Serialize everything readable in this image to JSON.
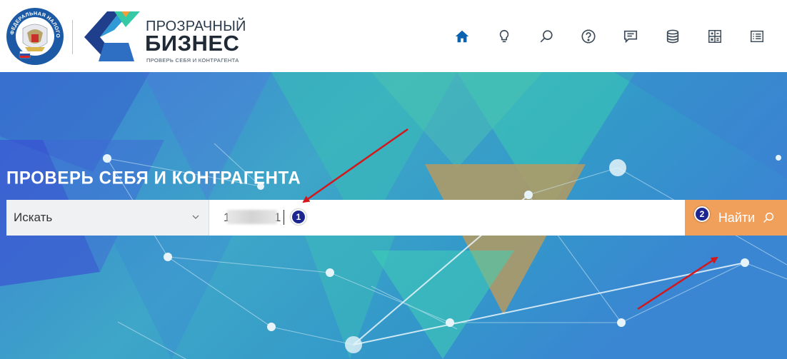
{
  "header": {
    "brand_line1": "ПРОЗРАЧНЫЙ",
    "brand_line2": "БИЗНЕС",
    "brand_tagline": "ПРОВЕРЬ СЕБЯ И КОНТРАГЕНТА",
    "emblem_text": "ФЕДЕРАЛЬНАЯ НАЛОГОВАЯ СЛУЖБА",
    "nav_icons": [
      "home-icon",
      "lightbulb-icon",
      "search-icon",
      "help-icon",
      "comment-icon",
      "database-icon",
      "calculator-icon",
      "list-icon"
    ]
  },
  "hero": {
    "title": "ПРОВЕРЬ СЕБЯ И КОНТРАГЕНТА",
    "search_select": "Искать",
    "search_value": "1           01",
    "search_button": "Найти"
  },
  "annotations": {
    "badge_1": "1",
    "badge_2": "2"
  },
  "colors": {
    "nav_active": "#0a63b0",
    "nav_icon": "#3c4a57",
    "button": "#f0a05a",
    "badge": "#1b2690",
    "arrow": "#d3171b"
  }
}
